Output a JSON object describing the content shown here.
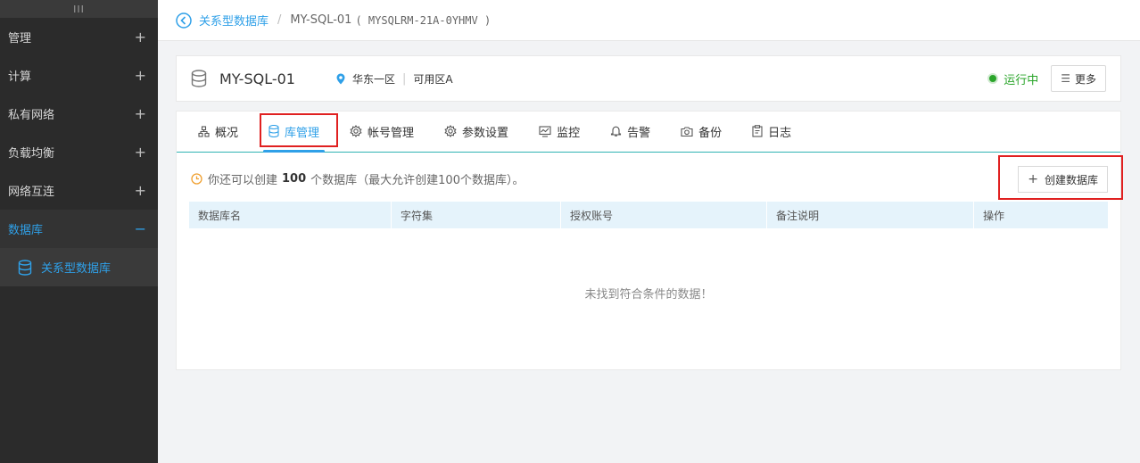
{
  "sidebar": {
    "handle": "III",
    "items": [
      {
        "label": "管理",
        "toggle": "+"
      },
      {
        "label": "计算",
        "toggle": "+"
      },
      {
        "label": "私有网络",
        "toggle": "+"
      },
      {
        "label": "负载均衡",
        "toggle": "+"
      },
      {
        "label": "网络互连",
        "toggle": "+"
      },
      {
        "label": "数据库",
        "toggle": "−"
      }
    ],
    "sub_item": "关系型数据库"
  },
  "breadcrumb": {
    "parent": "关系型数据库",
    "separator": "/",
    "current": "MY-SQL-01",
    "instance_id": "( MYSQLRM-21A-0YHMV )"
  },
  "instance": {
    "name": "MY-SQL-01",
    "region": "华东一区",
    "zone": "可用区A",
    "status": "运行中",
    "more_label": "更多"
  },
  "tabs": [
    {
      "label": "概况",
      "icon": "overview-icon"
    },
    {
      "label": "库管理",
      "icon": "database-icon"
    },
    {
      "label": "帐号管理",
      "icon": "gear-icon"
    },
    {
      "label": "参数设置",
      "icon": "settings-icon"
    },
    {
      "label": "监控",
      "icon": "monitor-icon"
    },
    {
      "label": "告警",
      "icon": "bell-icon"
    },
    {
      "label": "备份",
      "icon": "camera-icon"
    },
    {
      "label": "日志",
      "icon": "clipboard-icon"
    }
  ],
  "active_tab": "库管理",
  "notice": {
    "prefix": "你还可以创建",
    "count": "100",
    "suffix": "个数据库（最大允许创建100个数据库）。"
  },
  "create_button": {
    "plus": "+",
    "label": "创建数据库"
  },
  "table": {
    "columns": [
      "数据库名",
      "字符集",
      "授权账号",
      "备注说明",
      "操作"
    ],
    "rows": [],
    "empty_text": "未找到符合条件的数据！"
  },
  "colors": {
    "accent": "#2fa0e8",
    "status_running": "#2aa52a",
    "highlight_box": "#e02020",
    "sidebar_bg": "#2b2b2b"
  }
}
